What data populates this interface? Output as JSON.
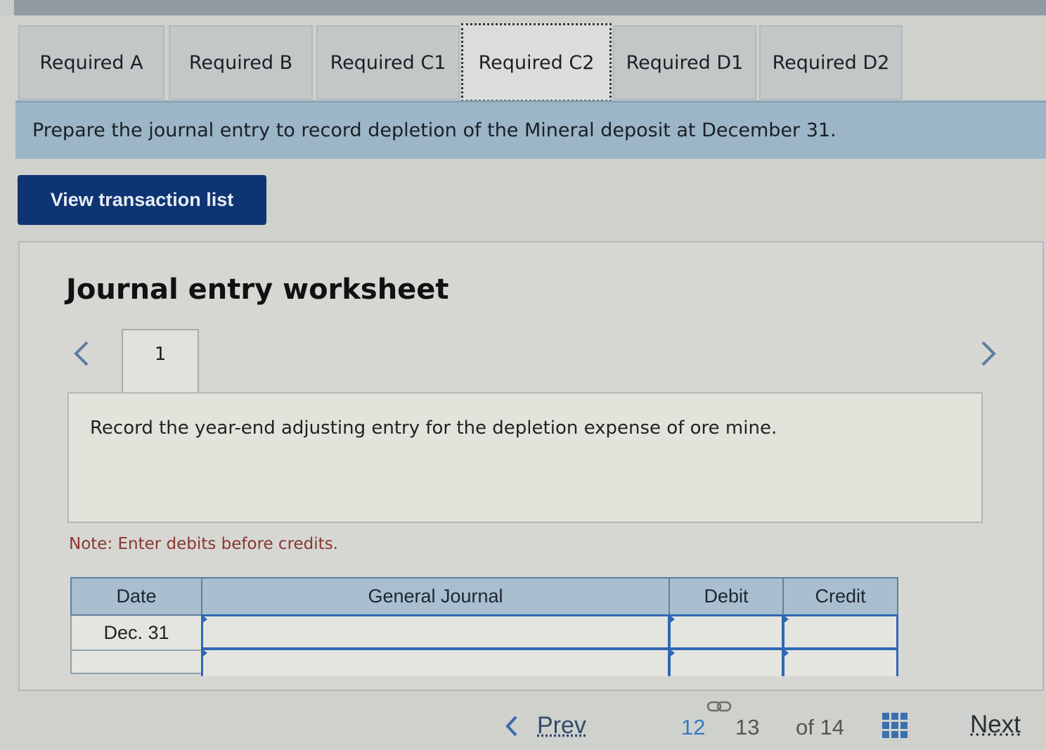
{
  "tabs": [
    {
      "label": "Required A"
    },
    {
      "label": "Required B"
    },
    {
      "label": "Required C1"
    },
    {
      "label": "Required C2",
      "active": true
    },
    {
      "label": "Required D1"
    },
    {
      "label": "Required D2"
    }
  ],
  "banner": {
    "text": "Prepare the journal entry to record depletion of the Mineral deposit at December 31."
  },
  "view_transaction_button": {
    "label": "View transaction list"
  },
  "worksheet": {
    "title": "Journal entry worksheet",
    "current_step": "1",
    "instruction": "Record the year-end adjusting entry for the depletion expense of ore mine.",
    "note": "Note: Enter debits before credits."
  },
  "journal_table": {
    "headers": {
      "date": "Date",
      "account": "General Journal",
      "debit": "Debit",
      "credit": "Credit"
    },
    "rows": [
      {
        "date": "Dec. 31",
        "account": "",
        "debit": "",
        "credit": ""
      },
      {
        "date": "",
        "account": "",
        "debit": "",
        "credit": ""
      }
    ]
  },
  "pagination": {
    "prev_label": "Prev",
    "current_page": "12",
    "next_page": "13",
    "of_label": "of 14",
    "next_label": "Next"
  },
  "colors": {
    "button_blue": "#0f3473",
    "banner_blue": "#9cb6c7",
    "header_blue": "#a9bfcf",
    "note_red": "#8a3730",
    "current_page_blue": "#3a78c8"
  }
}
